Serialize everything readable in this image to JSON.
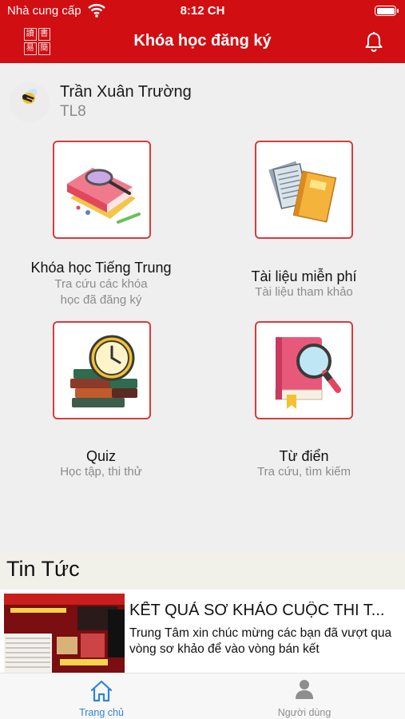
{
  "status_bar": {
    "carrier": "Nhà cung cấp",
    "time": "8:12 CH"
  },
  "header": {
    "title": "Khóa học đăng ký",
    "logo_chars": [
      "讀",
      "書",
      "易",
      "簡"
    ],
    "background_color": "#d10e12"
  },
  "profile": {
    "name": "Trần Xuân Trường",
    "code": "TL8"
  },
  "menu": [
    {
      "id": "courses",
      "title": "Khóa học Tiếng Trung",
      "subtitle": "Tra cứu các khóa học đã đăng ký",
      "icon": "books-magnifier-icon"
    },
    {
      "id": "documents",
      "title": "Tài liệu miễn phí",
      "subtitle": "Tài liệu tham khảo",
      "icon": "documents-icon"
    },
    {
      "id": "quiz",
      "title": "Quiz",
      "subtitle": "Học tập, thi thử",
      "icon": "books-clock-icon"
    },
    {
      "id": "dictionary",
      "title": "Từ điển",
      "subtitle": "Tra cứu, tìm kiếm",
      "icon": "book-search-icon"
    }
  ],
  "news": {
    "section_title": "Tin Tức",
    "items": [
      {
        "headline": "KẾT QUẢ SƠ KHẢO CUỘC THI T...",
        "summary": "Trung Tâm xin chúc mừng các bạn đã vượt qua vòng sơ khảo để vào vòng bán kết"
      }
    ]
  },
  "tabbar": {
    "home_label": "Trang chủ",
    "user_label": "Người dùng",
    "active_color": "#2f84d8",
    "inactive_color": "#8e8e8e"
  }
}
